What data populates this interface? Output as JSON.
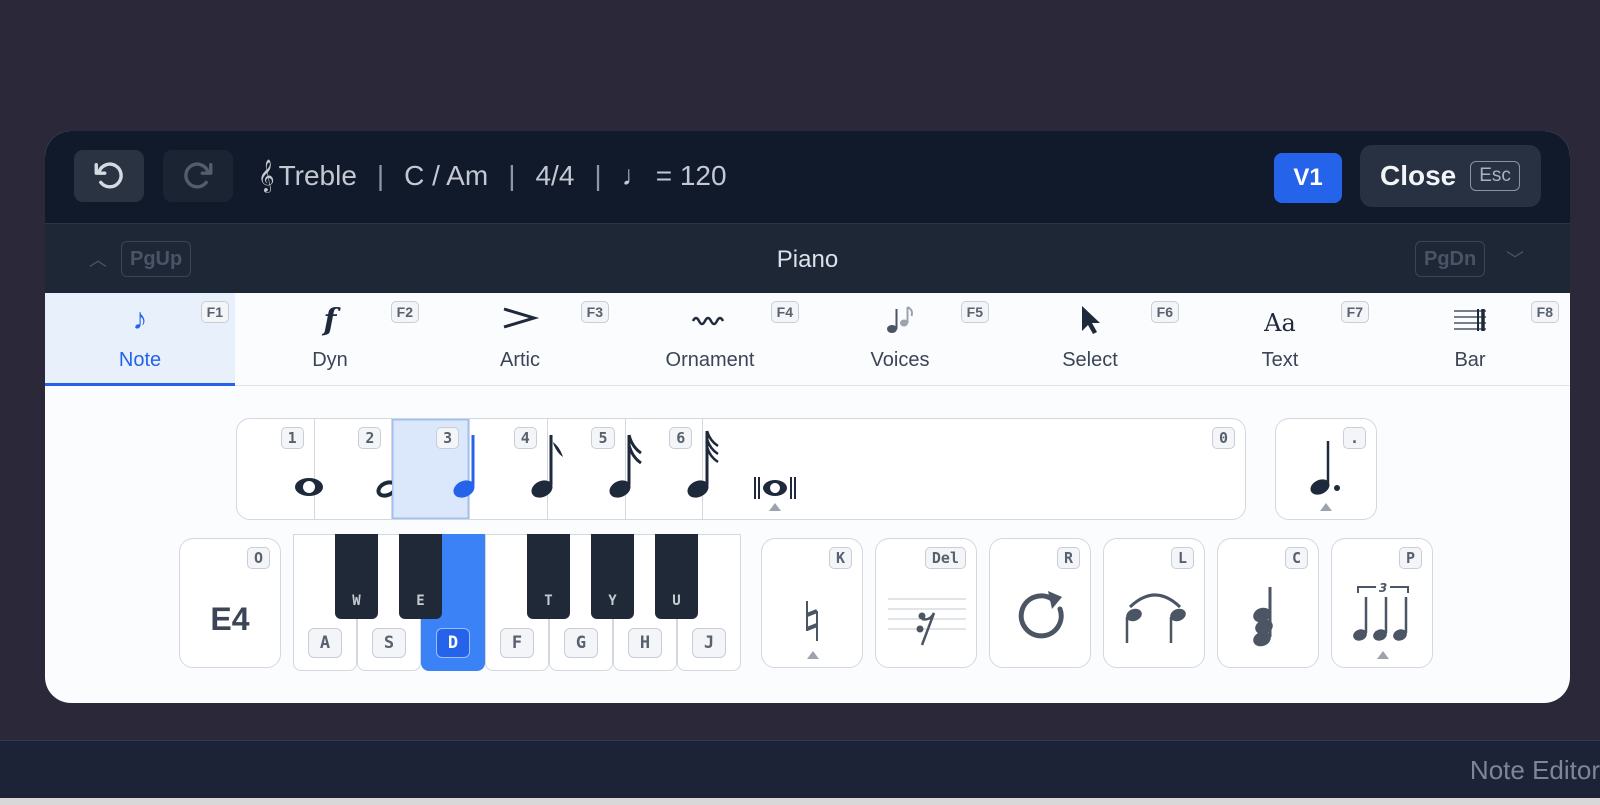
{
  "topbar": {
    "undo_icon": "undo-icon",
    "redo_icon": "redo-icon",
    "clef_symbol": "𝄞",
    "clef": "Treble",
    "key": "C / Am",
    "time": "4/4",
    "tempo_symbol": "♩",
    "tempo": "= 120",
    "separator": "|",
    "voice": "V1",
    "close_label": "Close",
    "close_key": "Esc"
  },
  "staff": {
    "name": "Piano",
    "prev_key": "PgUp",
    "next_key": "PgDn"
  },
  "tabs": [
    {
      "label": "Note",
      "key": "F1",
      "icon": "eighth-note-icon",
      "glyph": "♪",
      "active": true
    },
    {
      "label": "Dyn",
      "key": "F2",
      "icon": "forte-icon",
      "glyph": "𝆑",
      "active": false
    },
    {
      "label": "Artic",
      "key": "F3",
      "icon": "accent-icon",
      "glyph": ">",
      "active": false
    },
    {
      "label": "Ornament",
      "key": "F4",
      "icon": "trill-icon",
      "glyph": "〰",
      "active": false
    },
    {
      "label": "Voices",
      "key": "F5",
      "icon": "voices-icon",
      "glyph": "♫",
      "active": false
    },
    {
      "label": "Select",
      "key": "F6",
      "icon": "cursor-icon",
      "glyph": "➤",
      "active": false
    },
    {
      "label": "Text",
      "key": "F7",
      "icon": "text-icon",
      "glyph": "Aa",
      "active": false
    },
    {
      "label": "Bar",
      "key": "F8",
      "icon": "barline-icon",
      "glyph": "𝄁",
      "active": false
    }
  ],
  "durations": [
    {
      "name": "whole",
      "key": "1",
      "active": false
    },
    {
      "name": "half",
      "key": "2",
      "active": false
    },
    {
      "name": "quarter",
      "key": "3",
      "active": true
    },
    {
      "name": "eighth",
      "key": "4",
      "active": false
    },
    {
      "name": "sixteenth",
      "key": "5",
      "active": false
    },
    {
      "name": "thirty-second",
      "key": "6",
      "active": false
    },
    {
      "name": "breve",
      "key": "0",
      "active": false
    }
  ],
  "dot": {
    "key": "."
  },
  "octave": {
    "value": "E4",
    "key": "O"
  },
  "keyboard": {
    "white_keys": [
      {
        "label": "A",
        "active": false
      },
      {
        "label": "S",
        "active": false
      },
      {
        "label": "D",
        "active": true
      },
      {
        "label": "F",
        "active": false
      },
      {
        "label": "G",
        "active": false
      },
      {
        "label": "H",
        "active": false
      },
      {
        "label": "J",
        "active": false
      }
    ],
    "black_keys": [
      "W",
      "E",
      "T",
      "Y",
      "U"
    ]
  },
  "modifiers": [
    {
      "name": "natural",
      "key": "K"
    },
    {
      "name": "rest",
      "key": "Del"
    },
    {
      "name": "repeat",
      "key": "R"
    },
    {
      "name": "tie",
      "key": "L"
    },
    {
      "name": "chord",
      "key": "C"
    },
    {
      "name": "triplet",
      "key": "P"
    }
  ],
  "status": {
    "label": "Note Editor"
  },
  "colors": {
    "accent": "#2563eb",
    "header": "#111a2b",
    "background": "#2b2839"
  }
}
